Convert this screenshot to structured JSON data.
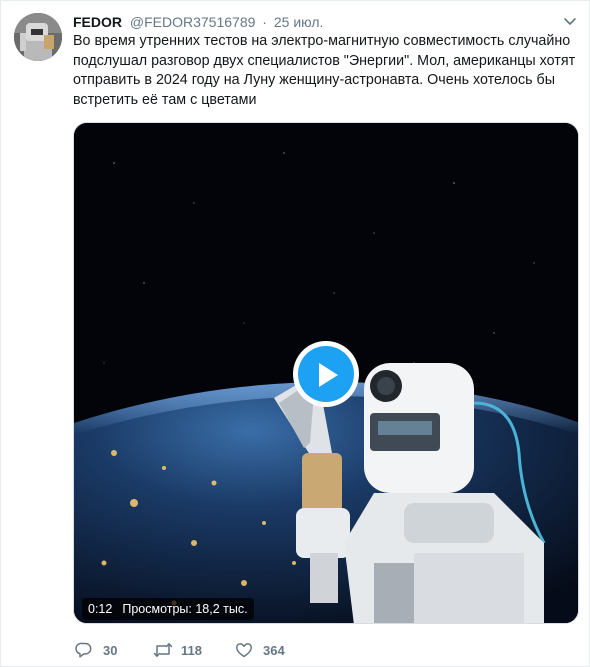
{
  "tweet": {
    "author_name": "FEDOR",
    "handle": "@FEDOR37516789",
    "separator": "·",
    "date": "25 июл.",
    "text_lines": [
      "Во время утренних тестов на электро-магнитную совместимость случайно",
      "подслушал разговор двух специалистов \"Энергии\". Мол, американцы хотят",
      "отправить в 2024 году на Луну женщину-астронавта. Очень хотелось бы",
      "встретить её там с цветами"
    ]
  },
  "video": {
    "duration": "0:12",
    "views": "Просмотры: 18,2 тыс.",
    "play_icon": "play-icon"
  },
  "actions": {
    "reply_count": "30",
    "retweet_count": "118",
    "like_count": "364"
  },
  "colors": {
    "accent": "#1da1f2",
    "secondary_text": "#657786",
    "primary_text": "#14171a"
  }
}
